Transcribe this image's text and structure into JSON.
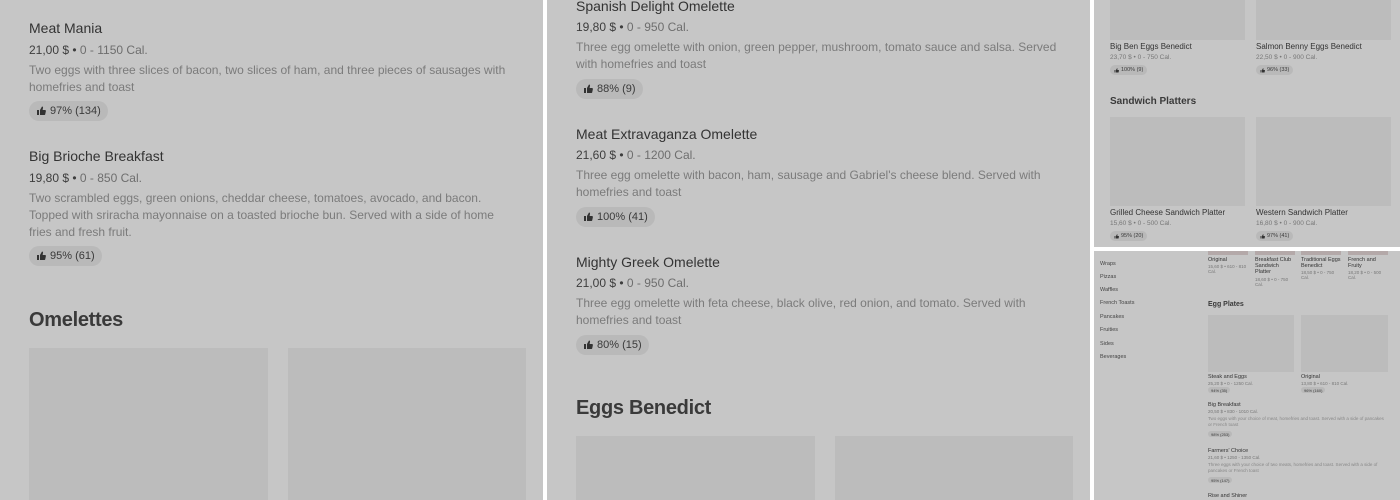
{
  "panel1": {
    "items": [
      {
        "title": "Meat Mania",
        "price": "21,00 $",
        "cal": "0 - 1150 Cal.",
        "desc": "Two eggs with three slices of bacon, two slices of ham, and three pieces of sausages with homefries and toast",
        "rating": "97% (134)"
      },
      {
        "title": "Big Brioche Breakfast",
        "price": "19,80 $",
        "cal": "0 - 850 Cal.",
        "desc": "Two scrambled eggs, green onions, cheddar cheese, tomatoes, avocado, and bacon. Topped with sriracha mayonnaise on a toasted brioche bun. Served with a side of home fries and fresh fruit.",
        "rating": "95% (61)"
      }
    ],
    "section": "Omelettes"
  },
  "panel2": {
    "items": [
      {
        "title": "Spanish Delight Omelette",
        "price": "19,80 $",
        "cal": "0 - 950 Cal.",
        "desc": "Three egg omelette with onion, green pepper, mushroom, tomato sauce and salsa. Served with homefries and toast",
        "rating": "88% (9)"
      },
      {
        "title": "Meat Extravaganza Omelette",
        "price": "21,60 $",
        "cal": "0 - 1200 Cal.",
        "desc": "Three egg omelette with bacon, ham, sausage and Gabriel's cheese blend. Served with homefries and toast",
        "rating": "100% (41)"
      },
      {
        "title": "Mighty Greek Omelette",
        "price": "21,00 $",
        "cal": "0 - 950 Cal.",
        "desc": "Three egg omelette with feta cheese, black olive, red onion, and tomato. Served with homefries and toast",
        "rating": "80% (15)"
      }
    ],
    "section": "Eggs Benedict"
  },
  "panel3": {
    "cards_top": [
      {
        "title": "Big Ben Eggs Benedict",
        "price": "23,70 $",
        "cal": "0 - 750 Cal.",
        "rating": "100% (9)"
      },
      {
        "title": "Salmon Benny Eggs Benedict",
        "price": "22,50 $",
        "cal": "0 - 900 Cal.",
        "rating": "96% (33)"
      }
    ],
    "section": "Sandwich Platters",
    "cards_bottom": [
      {
        "title": "Grilled Cheese Sandwich Platter",
        "price": "15,60 $",
        "cal": "0 - 500 Cal.",
        "rating": "95% (20)"
      },
      {
        "title": "Western Sandwich Platter",
        "price": "16,80 $",
        "cal": "0 - 900 Cal.",
        "rating": "97% (41)"
      }
    ]
  },
  "panel4": {
    "sidebar": [
      "Wraps",
      "Pizzas",
      "Waffles",
      "French Toasts",
      "Pancakes",
      "Fruities",
      "Sides",
      "Beverages"
    ],
    "top_cards": [
      {
        "title": "Original",
        "meta": "15,60 $ • 610 - 810 Cal."
      },
      {
        "title": "Breakfast Club Sandwich Platter",
        "meta": "18,60 $ • 0 - 750 Cal."
      },
      {
        "title": "Traditional Eggs Benedict",
        "meta": "18,50 $ • 0 - 750 Cal."
      },
      {
        "title": "French and Fruity",
        "meta": "18,20 $ • 0 - 500 Cal."
      }
    ],
    "section": "Egg Plates",
    "plate_cards": [
      {
        "title": "Steak and Eggs",
        "meta": "25,20 $ • 0 - 1250 Cal.",
        "rating": "94% (35)"
      },
      {
        "title": "Original",
        "meta": "13,80 $ • 610 - 810 Cal.",
        "rating": "96% (160)"
      }
    ],
    "list": [
      {
        "title": "Big Breakfast",
        "meta": "20,50 $ • 830 - 1010 Cal.",
        "desc": "Two eggs with your choice of meat, homefries and toast. Served with a side of pancakes or French toast",
        "rating": "98% (253)"
      },
      {
        "title": "Farmers' Choice",
        "meta": "21,60 $ • 1250 - 1350 Cal.",
        "desc": "Three eggs with your choice of two meats, homefries and toast. Served with a side of pancakes or French toast",
        "rating": "95% (147)"
      },
      {
        "title": "Rise and Shiner",
        "meta": "",
        "desc": "",
        "rating": ""
      }
    ]
  }
}
